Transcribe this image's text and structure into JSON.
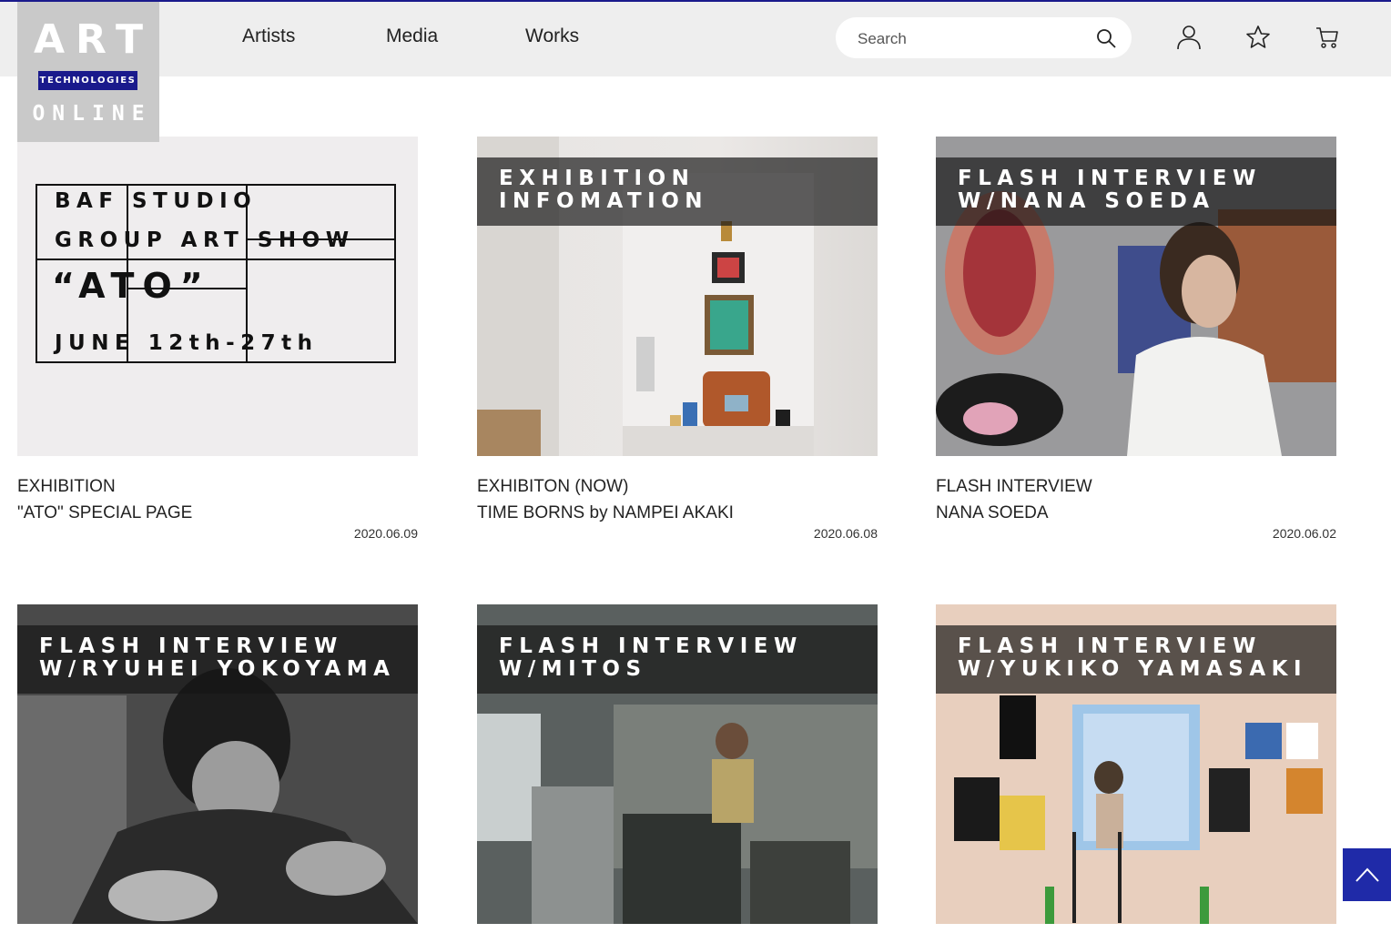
{
  "logo": {
    "line1": "ART",
    "line2": "TECHNOLOGIES",
    "line3": "ONLINE"
  },
  "nav": {
    "artists": "Artists",
    "media": "Media",
    "works": "Works"
  },
  "search": {
    "placeholder": "Search",
    "value": ""
  },
  "icons": {
    "search": "search-icon",
    "user": "user-icon",
    "favorite": "star-icon",
    "cart": "cart-icon",
    "back_to_top": "chevron-up-icon"
  },
  "colors": {
    "brand_navy": "#1a1a8c",
    "header_bg": "#eeeeee",
    "logo_bg": "#c9c9c9"
  },
  "cards": [
    {
      "poster": {
        "l1": "BAF STUDIO",
        "l2": "GROUP ART SHOW",
        "l3": "“ATO”",
        "l4": "JUNE 12th-27th"
      },
      "category": "EXHIBITION",
      "title": "\"ATO\" SPECIAL PAGE",
      "date": "2020.06.09"
    },
    {
      "overlay": [
        "EXHIBITION",
        "INFOMATION"
      ],
      "category": "EXHIBITON (NOW)",
      "title": "TIME BORNS by NAMPEI AKAKI",
      "date": "2020.06.08"
    },
    {
      "overlay": [
        "FLASH INTERVIEW",
        "W/NANA SOEDA"
      ],
      "category": "FLASH INTERVIEW",
      "title": "NANA SOEDA",
      "date": "2020.06.02"
    },
    {
      "overlay": [
        "FLASH INTERVIEW",
        "W/RYUHEI YOKOYAMA"
      ]
    },
    {
      "overlay": [
        "FLASH INTERVIEW",
        "W/MITOS"
      ]
    },
    {
      "overlay": [
        "FLASH INTERVIEW",
        "W/YUKIKO YAMASAKI"
      ]
    }
  ]
}
